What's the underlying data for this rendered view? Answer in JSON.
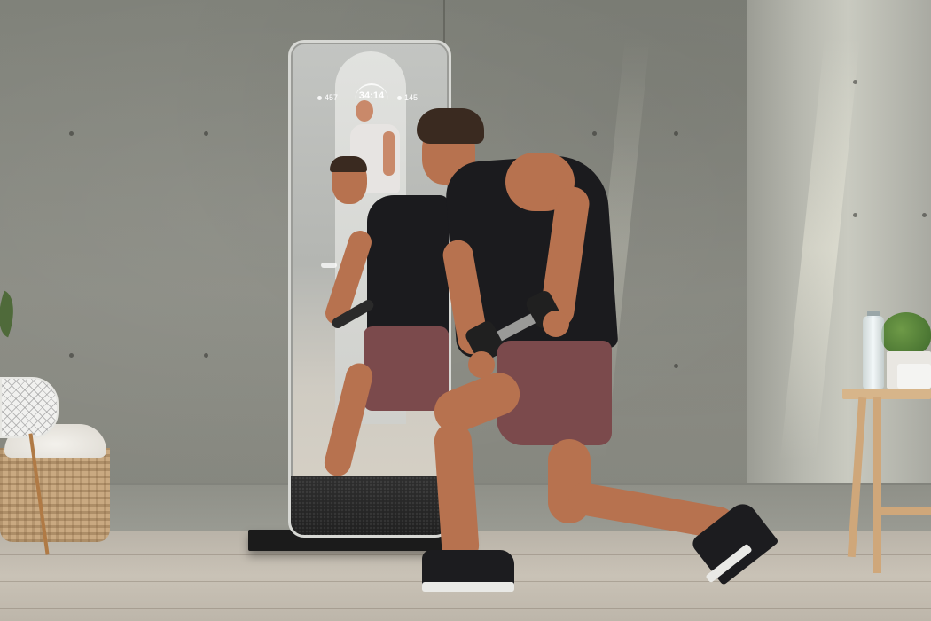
{
  "scene": {
    "description_colors": {
      "wall": "#8a8b84",
      "floor": "#c4bdb1",
      "mirror_frame": "#d7d8d4",
      "tank_top": "#1b1b1e",
      "shorts": "#7b4a4c"
    }
  },
  "mirror_display": {
    "left_stat": "457",
    "timer": "34:14",
    "right_stat": "145",
    "left_stat_icon": "flame-icon",
    "right_stat_icon": "heart-rate-icon"
  }
}
